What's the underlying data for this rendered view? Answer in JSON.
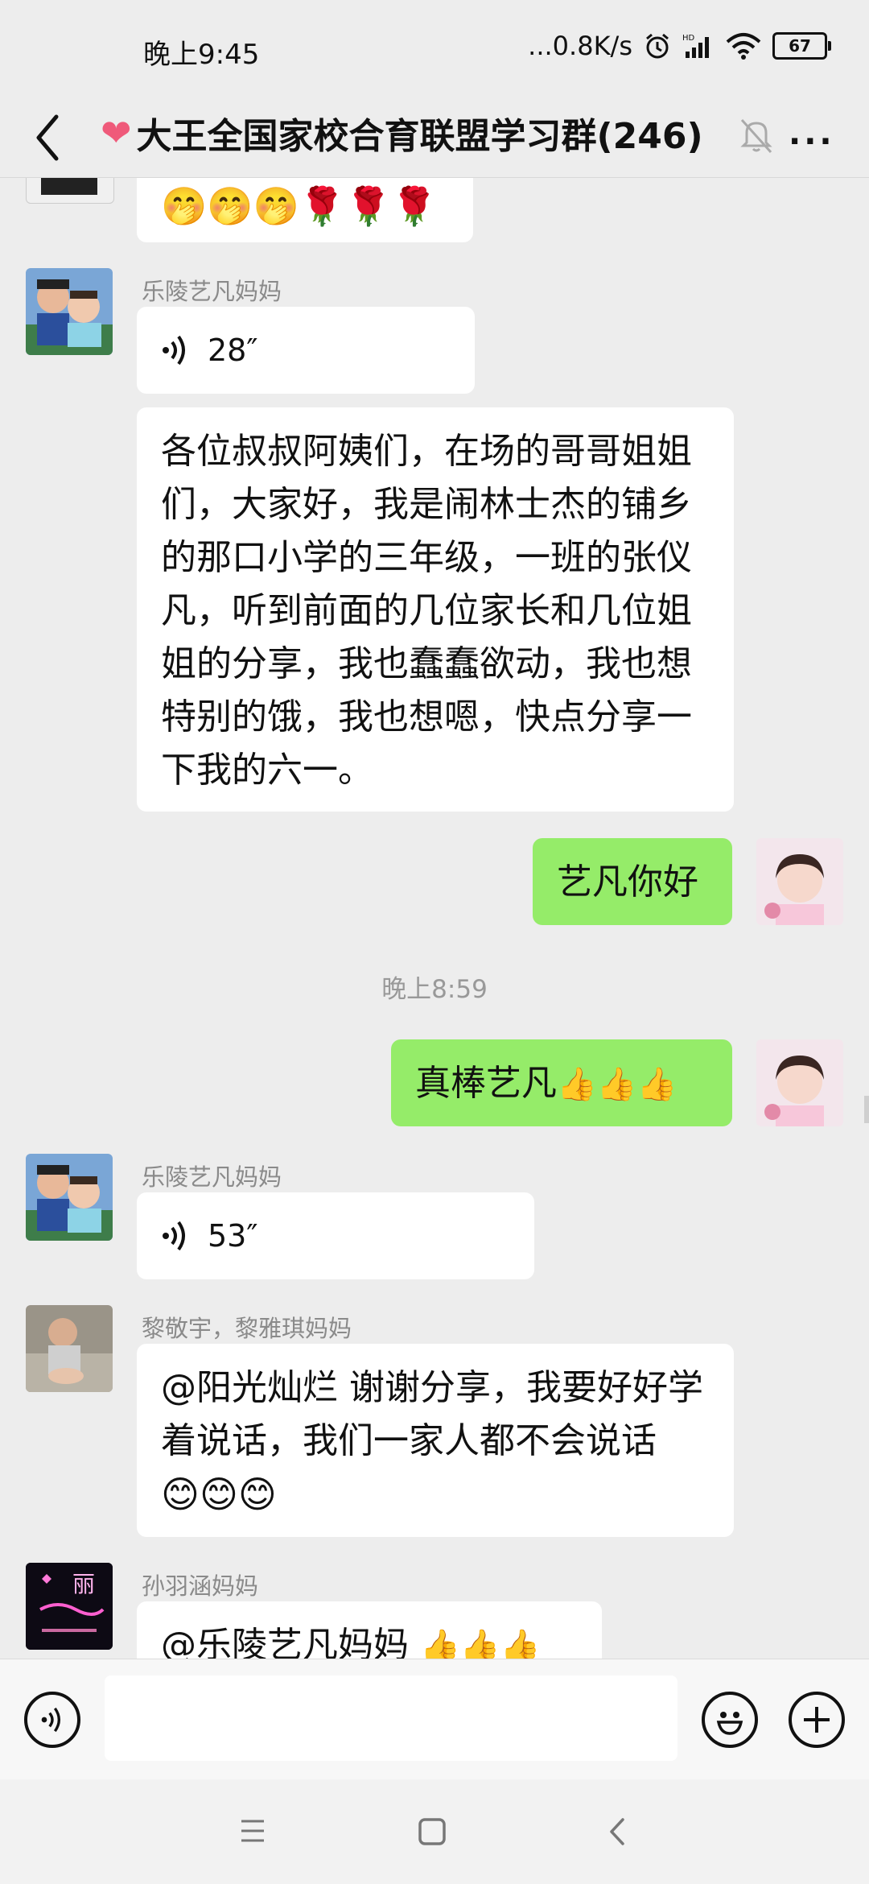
{
  "status_bar": {
    "time": "晚上9:45",
    "network_speed": "...0.8K/s",
    "battery": "67",
    "icons": [
      "alarm-icon",
      "hd-signal-icon",
      "wifi-icon",
      "battery-icon"
    ]
  },
  "header": {
    "heart": "❤",
    "title": "大王全国家校合育联盟学习群(246)",
    "more": "···"
  },
  "messages": {
    "top_emoji": "🤭🤭🤭🌹🌹🌹",
    "m1": {
      "sender": "乐陵艺凡妈妈",
      "duration": "28″"
    },
    "m2": {
      "text": "各位叔叔阿姨们，在场的哥哥姐姐们，大家好，我是闹林士杰的铺乡的那口小学的三年级，一班的张仪凡，听到前面的几位家长和几位姐姐的分享，我也蠢蠢欲动，我也想特别的饿，我也想嗯，快点分享一下我的六一。"
    },
    "m3": {
      "text": "艺凡你好"
    },
    "timestamp": "晚上8:59",
    "m4": {
      "text": "真棒艺凡",
      "emoji": "👍👍👍"
    },
    "m5": {
      "sender": "乐陵艺凡妈妈",
      "duration": "53″"
    },
    "m6": {
      "sender": "黎敬宇，黎雅琪妈妈",
      "text": "@阳光灿烂  谢谢分享，我要好好学着说话，我们一家人都不会说话",
      "emoji": "😊😊😊"
    },
    "m7": {
      "sender": "孙羽涵妈妈",
      "text": "@乐陵艺凡妈妈 ",
      "emoji": "👍👍👍",
      "avatar_text": "丽"
    }
  }
}
